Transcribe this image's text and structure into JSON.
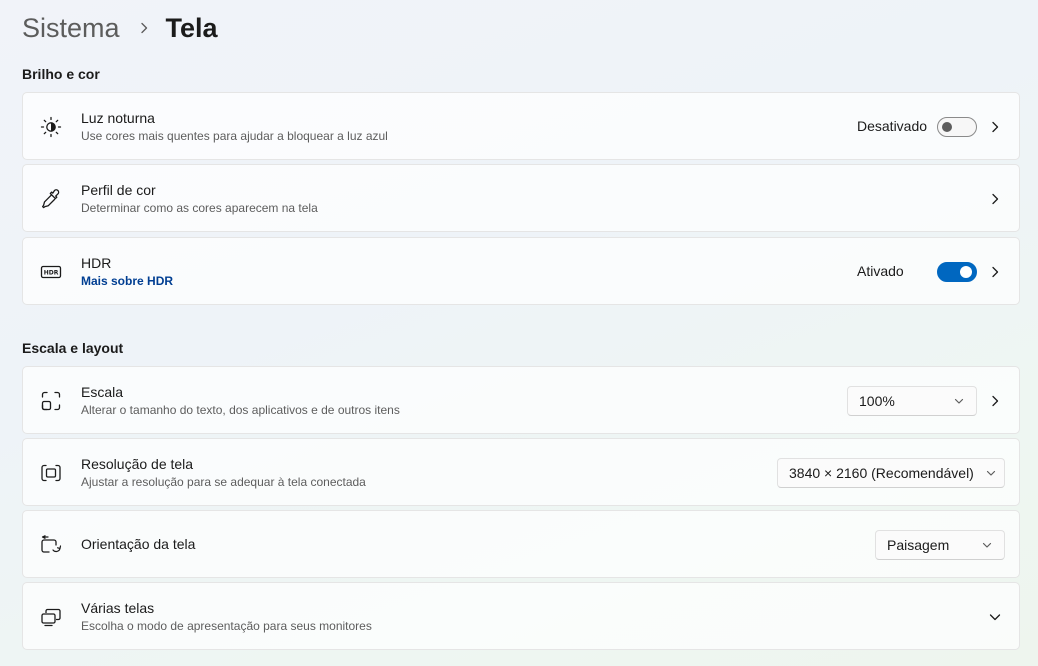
{
  "breadcrumb": {
    "parent": "Sistema",
    "current": "Tela"
  },
  "sections": {
    "brightness": {
      "heading": "Brilho e cor",
      "night_light": {
        "title": "Luz noturna",
        "description": "Use cores mais quentes para ajudar a bloquear a luz azul",
        "status": "Desativado",
        "toggle_on": false,
        "icon": "night-light-icon"
      },
      "color_profile": {
        "title": "Perfil de cor",
        "description": "Determinar como as cores aparecem na tela",
        "icon": "eyedropper-icon"
      },
      "hdr": {
        "title": "HDR",
        "link": "Mais sobre HDR",
        "status": "Ativado",
        "toggle_on": true,
        "icon": "hdr-icon"
      }
    },
    "scale_layout": {
      "heading": "Escala e layout",
      "scale": {
        "title": "Escala",
        "description": "Alterar o tamanho do texto, dos aplicativos e de outros itens",
        "value": "100%",
        "icon": "scale-icon"
      },
      "resolution": {
        "title": "Resolução de tela",
        "description": "Ajustar a resolução para se adequar à tela conectada",
        "value": "3840 × 2160 (Recomendável)",
        "icon": "resolution-icon"
      },
      "orientation": {
        "title": "Orientação da tela",
        "value": "Paisagem",
        "icon": "orientation-icon"
      },
      "multiple_displays": {
        "title": "Várias telas",
        "description": "Escolha o modo de apresentação para seus monitores",
        "icon": "multiple-displays-icon"
      }
    }
  },
  "colors": {
    "accent": "#0067c0",
    "link": "#003e92"
  }
}
